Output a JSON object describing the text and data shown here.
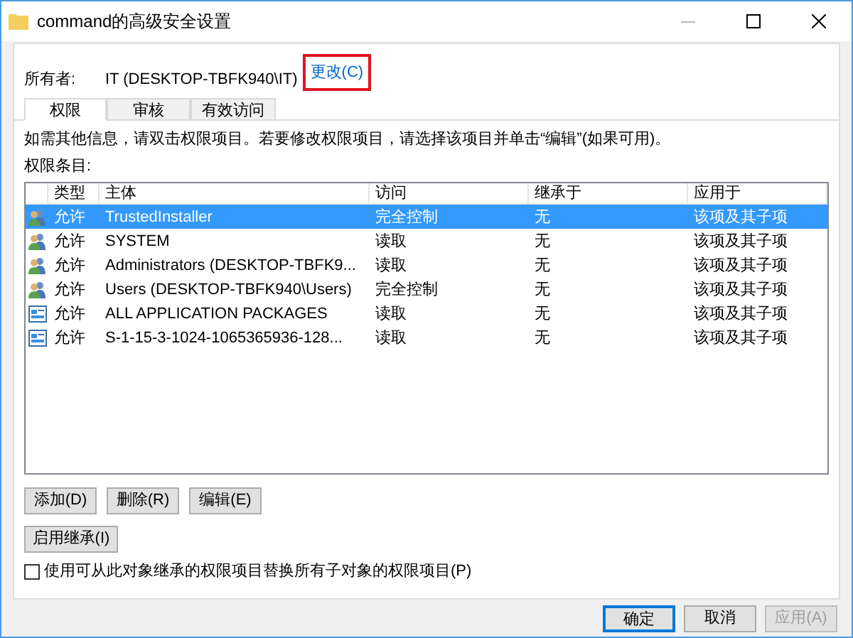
{
  "window": {
    "title": "command的高级安全设置"
  },
  "owner": {
    "label": "所有者:",
    "value": "IT (DESKTOP-TBFK940\\IT)",
    "change_link": "更改(C)",
    "highlighted": true
  },
  "tabs": [
    {
      "label": "权限",
      "selected": true
    },
    {
      "label": "审核",
      "selected": false
    },
    {
      "label": "有效访问",
      "selected": false
    }
  ],
  "instructions": "如需其他信息，请双击权限项目。若要修改权限项目，请选择该项目并单击“编辑”(如果可用)。",
  "list_label": "权限条目:",
  "table": {
    "columns": [
      "类型",
      "主体",
      "访问",
      "继承于",
      "应用于"
    ],
    "rows": [
      {
        "kind": "user",
        "selected": true,
        "cells": [
          "允许",
          "TrustedInstaller",
          "完全控制",
          "无",
          "该项及其子项"
        ]
      },
      {
        "kind": "user",
        "selected": false,
        "cells": [
          "允许",
          "SYSTEM",
          "读取",
          "无",
          "该项及其子项"
        ]
      },
      {
        "kind": "user",
        "selected": false,
        "cells": [
          "允许",
          "Administrators (DESKTOP-TBFK9...",
          "读取",
          "无",
          "该项及其子项"
        ]
      },
      {
        "kind": "user",
        "selected": false,
        "cells": [
          "允许",
          "Users (DESKTOP-TBFK940\\Users)",
          "完全控制",
          "无",
          "该项及其子项"
        ]
      },
      {
        "kind": "package",
        "selected": false,
        "cells": [
          "允许",
          "ALL APPLICATION PACKAGES",
          "读取",
          "无",
          "该项及其子项"
        ]
      },
      {
        "kind": "package",
        "selected": false,
        "cells": [
          "允许",
          "S-1-15-3-1024-1065365936-128...",
          "读取",
          "无",
          "该项及其子项"
        ]
      }
    ]
  },
  "action_buttons": [
    "添加(D)",
    "删除(R)",
    "编辑(E)"
  ],
  "inherit_button": "启用继承(I)",
  "replace_option": {
    "label": "使用可从此对象继承的权限项目替换所有子对象的权限项目(P)",
    "checked": false
  },
  "footer_buttons": [
    {
      "label": "确定",
      "disabled": false,
      "default": true
    },
    {
      "label": "取消",
      "disabled": false,
      "default": false
    },
    {
      "label": "应用(A)",
      "disabled": true,
      "default": false
    }
  ]
}
